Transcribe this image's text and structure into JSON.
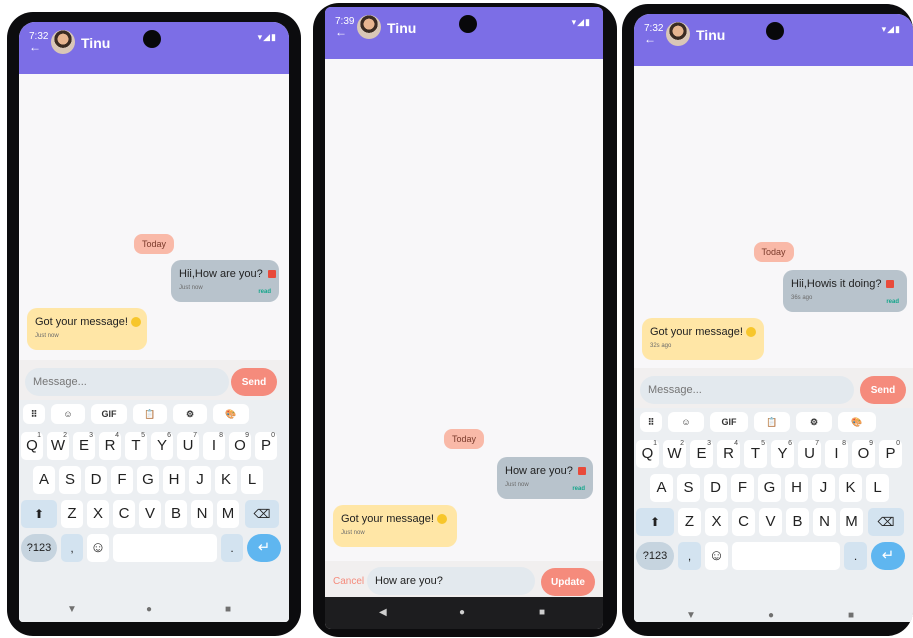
{
  "screens": [
    {
      "time": "7:32",
      "back": "←",
      "contact": "Tinu",
      "status_icons": "▾◢▮",
      "date_chip": "Today",
      "messages": [
        {
          "text": "Hii,How are you?",
          "time": "Just now",
          "read": "read",
          "delete_icon": "trash-icon"
        },
        {
          "text": "Got your message!",
          "time": "Just now",
          "emoji": "smile-emoji"
        }
      ],
      "input_placeholder": "Message...",
      "send_label": "Send"
    },
    {
      "time": "7:39",
      "back": "←",
      "contact": "Tinu",
      "status_icons": "▾◢▮",
      "date_chip": "Today",
      "messages": [
        {
          "text": "How are you?",
          "time": "Just now",
          "read": "read",
          "delete_icon": "trash-icon"
        },
        {
          "text": "Got your message!",
          "time": "Just now",
          "emoji": "smile-emoji"
        }
      ],
      "cancel_label": "Cancel",
      "edit_value": "How are you?",
      "update_label": "Update"
    },
    {
      "time": "7:32",
      "back": "←",
      "contact": "Tinu",
      "status_icons": "▾◢▮",
      "date_chip": "Today",
      "messages": [
        {
          "text": "Hii,Howis it  doing?",
          "time": "36s ago",
          "read": "read",
          "delete_icon": "trash-icon"
        },
        {
          "text": "Got your message!",
          "time": "32s ago",
          "emoji": "smile-emoji"
        }
      ],
      "input_placeholder": "Message...",
      "send_label": "Send"
    }
  ],
  "keyboard": {
    "tools": [
      "⠿",
      "☺",
      "GIF",
      "📋",
      "⚙",
      "🎨"
    ],
    "row1": [
      "Q",
      "W",
      "E",
      "R",
      "T",
      "Y",
      "U",
      "I",
      "O",
      "P"
    ],
    "row1_digits": [
      "1",
      "2",
      "3",
      "4",
      "5",
      "6",
      "7",
      "8",
      "9",
      "0"
    ],
    "row2": [
      "A",
      "S",
      "D",
      "F",
      "G",
      "H",
      "J",
      "K",
      "L"
    ],
    "row3": [
      "Z",
      "X",
      "C",
      "V",
      "B",
      "N",
      "M"
    ],
    "shift": "⬆",
    "backspace": "⌫",
    "num_key": "?123",
    "comma": ",",
    "emoji_key": "☺",
    "period": ".",
    "enter": "↵"
  },
  "nav": {
    "back": "▼",
    "home": "●",
    "recents": "■",
    "back_alt": "◀"
  },
  "colors": {
    "appbar": "#7c6ee6",
    "send": "#f58b7c",
    "out_bubble": "#b8c3cc",
    "in_bubble": "#ffe6a6",
    "read": "#13a58a"
  }
}
